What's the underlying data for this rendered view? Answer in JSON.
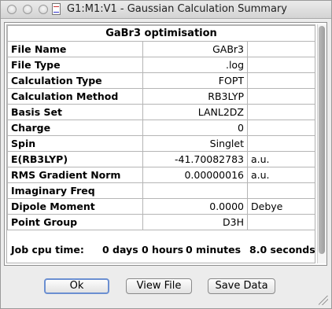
{
  "window": {
    "title": "G1:M1:V1 - Gaussian Calculation Summary"
  },
  "summary": {
    "header": "GaBr3 optimisation",
    "rows": [
      {
        "label": "File Name",
        "value": "GABr3",
        "unit": ""
      },
      {
        "label": "File Type",
        "value": ".log",
        "unit": ""
      },
      {
        "label": "Calculation Type",
        "value": "FOPT",
        "unit": ""
      },
      {
        "label": "Calculation Method",
        "value": "RB3LYP",
        "unit": ""
      },
      {
        "label": "Basis Set",
        "value": "LANL2DZ",
        "unit": ""
      },
      {
        "label": "Charge",
        "value": "0",
        "unit": ""
      },
      {
        "label": "Spin",
        "value": "Singlet",
        "unit": ""
      },
      {
        "label": "E(RB3LYP)",
        "value": "-41.70082783",
        "unit": "a.u."
      },
      {
        "label": "RMS Gradient Norm",
        "value": "0.00000016",
        "unit": "a.u."
      },
      {
        "label": "Imaginary Freq",
        "value": "",
        "unit": ""
      },
      {
        "label": "Dipole Moment",
        "value": "0.0000",
        "unit": "Debye"
      },
      {
        "label": "Point Group",
        "value": "D3H",
        "unit": ""
      }
    ],
    "job_cpu": {
      "label": "Job cpu time:",
      "days": "0 days",
      "hours": "0 hours",
      "minutes": "0 minutes",
      "seconds": "8.0 seconds."
    }
  },
  "buttons": {
    "ok": "Ok",
    "view_file": "View File",
    "save_data": "Save Data"
  }
}
